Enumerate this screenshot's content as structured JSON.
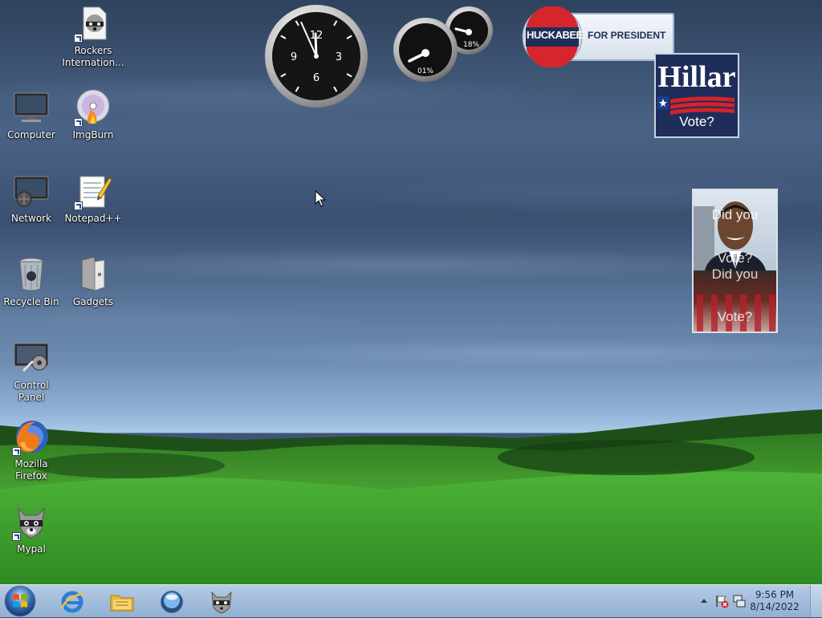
{
  "desktop_icons": [
    {
      "label": "Rockers Internation...",
      "icon": "raccoon-document-icon"
    },
    {
      "label": "Computer",
      "icon": "monitor-icon"
    },
    {
      "label": "ImgBurn",
      "icon": "disc-burn-icon"
    },
    {
      "label": "Network",
      "icon": "network-icon"
    },
    {
      "label": "Notepad++",
      "icon": "notepad-icon"
    },
    {
      "label": "Recycle Bin",
      "icon": "recycle-bin-icon"
    },
    {
      "label": "Gadgets",
      "icon": "gadgets-icon"
    },
    {
      "label": "Control Panel",
      "icon": "control-panel-icon"
    },
    {
      "label": "Mozilla Firefox",
      "icon": "firefox-icon"
    },
    {
      "label": "Mypal",
      "icon": "raccoon-icon"
    }
  ],
  "gadgets": {
    "clock": {
      "numbers": [
        "12",
        "3",
        "6",
        "9"
      ],
      "hour": 11,
      "minute": 56
    },
    "cpu_meter": {
      "cpu_label": "01%",
      "memory_label": "18%",
      "cpu": 1,
      "memory": 18
    },
    "huckabee": {
      "name": "HUCKABEE",
      "tagline": "FOR PRESIDENT"
    },
    "hillary": {
      "title": "Hillar",
      "subtitle": "Vote?"
    },
    "obama": {
      "line1": "Did you",
      "line2": "Vote?",
      "line3": "Did you",
      "line4": "Vote?"
    }
  },
  "taskbar": {
    "start": "start-orb-icon",
    "pinned": [
      "internet-explorer-icon",
      "file-explorer-icon",
      "windows-media-icon",
      "mypal-raccoon-icon"
    ],
    "tray": {
      "time": "9:56 PM",
      "date": "8/14/2022"
    }
  },
  "colors": {
    "taskbar": "#a5bedc",
    "sky": "#4a6386",
    "grass": "#3f9a2c"
  }
}
